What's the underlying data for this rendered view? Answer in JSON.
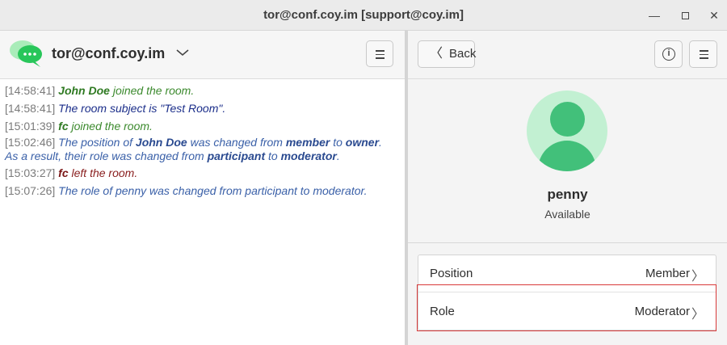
{
  "window": {
    "title": "tor@conf.coy.im [support@coy.im]",
    "minimize_glyph": "—",
    "close_glyph": "✕"
  },
  "left_panel": {
    "account": "tor@conf.coy.im",
    "logo_icon": "chat-bubbles-icon",
    "menu_icon": "hamburger-icon",
    "log": [
      {
        "time": "[14:58:41]",
        "parts": [
          "John Doe",
          " joined the room."
        ]
      },
      {
        "time": "[14:58:41]",
        "text": "The room subject is \"Test Room\"."
      },
      {
        "time": "[15:01:39]",
        "parts": [
          "fc",
          " joined the room."
        ]
      },
      {
        "time": "[15:02:46]",
        "parts": [
          "The position of ",
          "John Doe",
          " was changed from ",
          "member",
          " to ",
          "owner",
          "."
        ],
        "continuation": [
          "As a result, their role was changed from ",
          "participant",
          " to ",
          "moderator",
          "."
        ]
      },
      {
        "time": "[15:03:27]",
        "parts": [
          "fc",
          " left the room."
        ]
      },
      {
        "time": "[15:07:26]",
        "text": "The role of penny was changed from participant to moderator."
      }
    ]
  },
  "right_panel": {
    "back_label": "Back",
    "info_icon": "info-icon",
    "menu_icon": "hamburger-icon",
    "avatar_icon": "user-avatar-icon",
    "name": "penny",
    "status": "Available",
    "rows": [
      {
        "key": "Position",
        "value": "Member"
      },
      {
        "key": "Role",
        "value": "Moderator"
      }
    ],
    "chevron": "〉"
  },
  "colors": {
    "avatar_bg": "#c2f0d2",
    "avatar_fg": "#42c07a",
    "highlight": "#d83a3a",
    "join_text": "#3c8a2e",
    "info_text": "#3a60a8",
    "leave_text": "#8a2020"
  }
}
